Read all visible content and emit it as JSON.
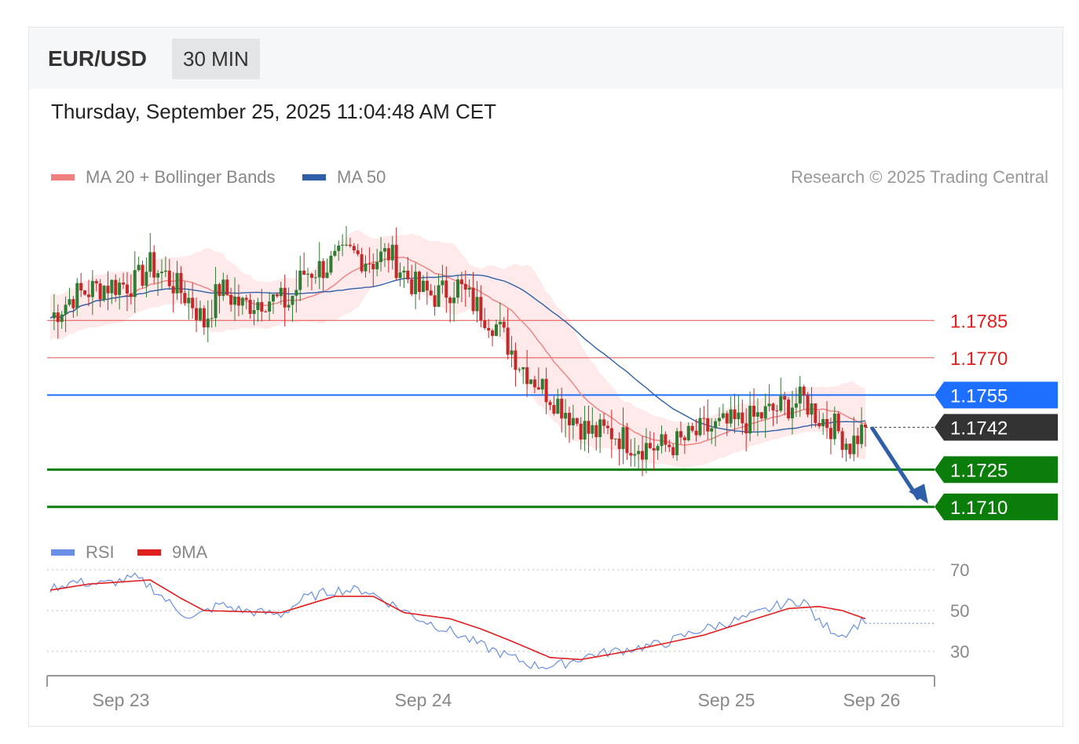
{
  "header": {
    "pair": "EUR/USD",
    "timeframe": "30 MIN"
  },
  "timestamp": "Thursday, September 25, 2025 11:04:48 AM CET",
  "legend": {
    "ma20": "MA 20 + Bollinger Bands",
    "ma50": "MA 50",
    "rsi": "RSI",
    "ma9": "9MA"
  },
  "credit": "Research © 2025 Trading Central",
  "colors": {
    "ma20": "#f08080",
    "ma50": "#2f5fa8",
    "rsi": "#6a8fe6",
    "ma9": "#e01e1e",
    "up": "#2e7d32",
    "down": "#c62828",
    "bands": "#fde3e3"
  },
  "chart_data": [
    {
      "type": "candlestick",
      "title": "EUR/USD 30 MIN",
      "x_ticks": [
        "Sep 23",
        "Sep 24",
        "Sep 25",
        "Sep 26"
      ],
      "ylim": [
        1.1703,
        1.1835
      ],
      "levels": [
        {
          "label": "1.1785",
          "value": 1.1785,
          "style": "resistance",
          "color": "#e02020"
        },
        {
          "label": "1.1770",
          "value": 1.177,
          "style": "resistance",
          "color": "#e02020"
        },
        {
          "label": "1.1755",
          "value": 1.1755,
          "style": "pivot",
          "color": "#1f6fff"
        },
        {
          "label": "1.1742",
          "value": 1.1742,
          "style": "current",
          "color": "#333333"
        },
        {
          "label": "1.1725",
          "value": 1.1725,
          "style": "support",
          "color": "#0a7d0a"
        },
        {
          "label": "1.1710",
          "value": 1.171,
          "style": "support",
          "color": "#0a7d0a"
        }
      ],
      "close_anchors": [
        [
          0,
          1.1786
        ],
        [
          6,
          1.1795
        ],
        [
          14,
          1.1799
        ],
        [
          22,
          1.18
        ],
        [
          26,
          1.1807
        ],
        [
          30,
          1.1803
        ],
        [
          37,
          1.1792
        ],
        [
          40,
          1.1784
        ],
        [
          44,
          1.1798
        ],
        [
          50,
          1.1791
        ],
        [
          56,
          1.1794
        ],
        [
          62,
          1.1792
        ],
        [
          66,
          1.1804
        ],
        [
          72,
          1.1807
        ],
        [
          78,
          1.1812
        ],
        [
          84,
          1.1809
        ],
        [
          88,
          1.1812
        ],
        [
          92,
          1.1804
        ],
        [
          96,
          1.1797
        ],
        [
          100,
          1.1795
        ],
        [
          106,
          1.1799
        ],
        [
          110,
          1.1792
        ],
        [
          116,
          1.1783
        ],
        [
          122,
          1.1768
        ],
        [
          128,
          1.1758
        ],
        [
          134,
          1.1749
        ],
        [
          140,
          1.174
        ],
        [
          146,
          1.174
        ],
        [
          152,
          1.1735
        ],
        [
          158,
          1.1734
        ],
        [
          164,
          1.1736
        ],
        [
          170,
          1.1741
        ],
        [
          176,
          1.1743
        ],
        [
          182,
          1.1745
        ],
        [
          190,
          1.175
        ],
        [
          196,
          1.1753
        ],
        [
          200,
          1.1746
        ],
        [
          204,
          1.1742
        ],
        [
          208,
          1.1735
        ],
        [
          212,
          1.1742
        ]
      ],
      "ma_note": "MA 20 with Bollinger Bands and MA 50 overlays"
    },
    {
      "type": "line",
      "title": "RSI",
      "ylim": [
        20,
        80
      ],
      "yticks": [
        70,
        50,
        30
      ],
      "series": [
        {
          "name": "RSI",
          "anchors": [
            [
              0,
              61
            ],
            [
              6,
              64
            ],
            [
              14,
              63
            ],
            [
              22,
              66
            ],
            [
              26,
              62
            ],
            [
              32,
              52
            ],
            [
              37,
              46
            ],
            [
              44,
              53
            ],
            [
              50,
              50
            ],
            [
              60,
              48
            ],
            [
              66,
              56
            ],
            [
              74,
              60
            ],
            [
              82,
              60
            ],
            [
              90,
              52
            ],
            [
              96,
              46
            ],
            [
              104,
              40
            ],
            [
              112,
              33
            ],
            [
              120,
              27
            ],
            [
              126,
              23
            ],
            [
              132,
              23
            ],
            [
              140,
              28
            ],
            [
              150,
              31
            ],
            [
              160,
              34
            ],
            [
              168,
              40
            ],
            [
              176,
              44
            ],
            [
              182,
              47
            ],
            [
              190,
              53
            ],
            [
              196,
              55
            ],
            [
              200,
              44
            ],
            [
              206,
              38
            ],
            [
              212,
              46
            ]
          ]
        },
        {
          "name": "9MA",
          "anchors": [
            [
              0,
              60
            ],
            [
              10,
              63
            ],
            [
              26,
              65
            ],
            [
              34,
              56
            ],
            [
              40,
              50
            ],
            [
              60,
              49
            ],
            [
              74,
              57
            ],
            [
              84,
              57
            ],
            [
              92,
              49
            ],
            [
              104,
              46
            ],
            [
              112,
              41
            ],
            [
              120,
              35
            ],
            [
              130,
              27
            ],
            [
              138,
              26
            ],
            [
              150,
              30
            ],
            [
              160,
              34
            ],
            [
              170,
              38
            ],
            [
              180,
              44
            ],
            [
              192,
              51
            ],
            [
              200,
              52
            ],
            [
              206,
              50
            ],
            [
              212,
              46
            ]
          ]
        }
      ]
    }
  ]
}
